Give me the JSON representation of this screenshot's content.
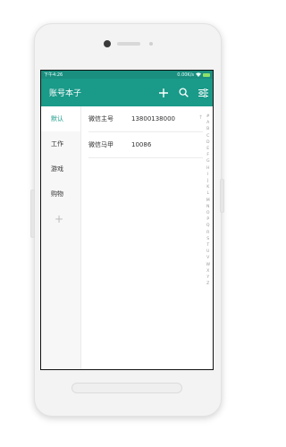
{
  "status_bar": {
    "time": "下午4:26",
    "net_speed": "0.00K/s"
  },
  "app_bar": {
    "title": "账号本子",
    "add_icon": "plus-icon",
    "search_icon": "search-icon",
    "filter_icon": "filter-icon"
  },
  "groups": [
    {
      "label": "默认",
      "selected": true
    },
    {
      "label": "工作",
      "selected": false
    },
    {
      "label": "游戏",
      "selected": false
    },
    {
      "label": "购物",
      "selected": false
    }
  ],
  "add_group_label": "+",
  "accounts": [
    {
      "name": "微信主号",
      "value": "13800138000",
      "pin": "↑"
    },
    {
      "name": "微信马甲",
      "value": "10086",
      "pin": ""
    }
  ],
  "index_letters": [
    "#",
    "A",
    "B",
    "C",
    "D",
    "E",
    "F",
    "G",
    "H",
    "I",
    "J",
    "K",
    "L",
    "M",
    "N",
    "O",
    "P",
    "Q",
    "R",
    "S",
    "T",
    "U",
    "V",
    "W",
    "X",
    "Y",
    "Z"
  ],
  "colors": {
    "primary": "#1a9a89",
    "status": "#1a8f80"
  }
}
